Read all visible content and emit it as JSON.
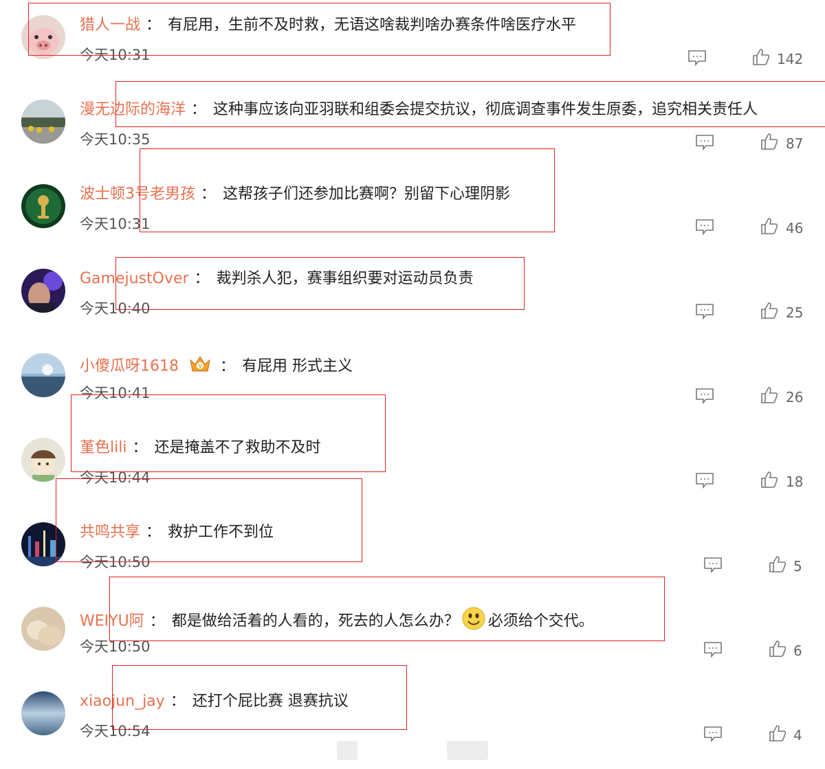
{
  "comments": [
    {
      "user": "猎人一战",
      "text": "有屁用，生前不及时救，无语这啥裁判啥办赛条件啥医疗水平",
      "time": "今天10:31",
      "likes": "142"
    },
    {
      "user": "漫无边际的海洋",
      "text": "这种事应该向亚羽联和组委会提交抗议，彻底调查事件发生原委，追究相关责任人",
      "time": "今天10:35",
      "likes": "87"
    },
    {
      "user": "波士顿3号老男孩",
      "text": "这帮孩子们还参加比赛啊？别留下心理阴影",
      "time": "今天10:31",
      "likes": "46"
    },
    {
      "user": "GamejustOver",
      "text": "裁判杀人犯，赛事组织要对运动员负责",
      "time": "今天10:40",
      "likes": "25"
    },
    {
      "user": "小傻瓜呀1618",
      "text": "有屁用 形式主义",
      "time": "今天10:41",
      "likes": "26"
    },
    {
      "user": "堇色lili",
      "text": "还是掩盖不了救助不及时",
      "time": "今天10:44",
      "likes": "18"
    },
    {
      "user": "共鸣共享",
      "text": "救护工作不到位",
      "time": "今天10:50",
      "likes": "5"
    },
    {
      "user": "WEIYU阿",
      "text": "都是做给活着的人看的，死去的人怎么办？",
      "text2": "必须给个交代。",
      "time": "今天10:50",
      "likes": "6"
    },
    {
      "user": "xiaojun_jay",
      "text": "还打个屁比赛 退赛抗议",
      "time": "今天10:54",
      "likes": "4"
    }
  ],
  "separator": "：",
  "colors": {
    "username": "#e8714f",
    "highlight_box": "#e02020",
    "text": "#222222",
    "meta": "#666666"
  },
  "icons": {
    "reply": "comment-reply-icon",
    "like": "thumbs-up-icon",
    "badge": "crown-badge-icon",
    "emoji": "smiley-emoji-icon"
  }
}
